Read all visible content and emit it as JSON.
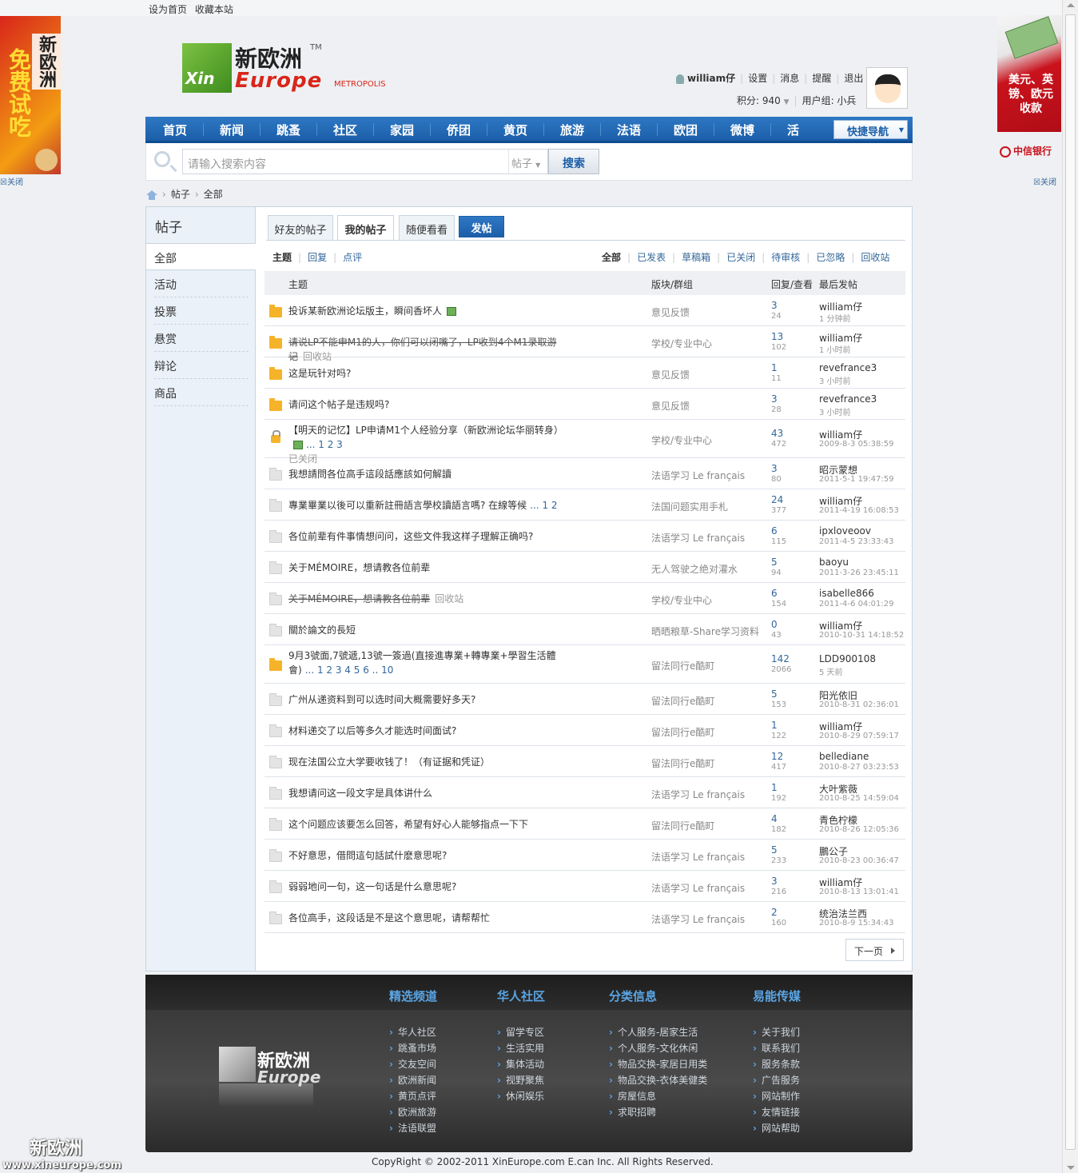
{
  "topbar": {
    "set_home": "设为首页",
    "bookmark": "收藏本站"
  },
  "ads": {
    "left_big": "免费试吃",
    "left_small": "新欧洲",
    "left_close": "☒关闭",
    "right_text": "美元、英镑、欧元收款",
    "right_bank": "中信银行",
    "right_close": "☒关闭"
  },
  "logo": {
    "cn": "新欧洲",
    "tm": "TM",
    "box": "Xin",
    "en": "Europe",
    "metro": "METROPOLIS"
  },
  "user": {
    "name": "william仔",
    "settings": "设置",
    "messages": "消息",
    "reminders": "提醒",
    "logout": "退出",
    "points": "积分: 940",
    "group": "用户组: 小兵"
  },
  "nav": {
    "items": [
      "首页",
      "新闻",
      "跳蚤",
      "社区",
      "家园",
      "侨团",
      "黄页",
      "旅游",
      "法语",
      "欧团",
      "微博",
      "活"
    ],
    "quick": "快捷导航"
  },
  "search": {
    "placeholder": "请输入搜索内容",
    "type": "帖子",
    "button": "搜索"
  },
  "breadcrumb": {
    "a": "帖子",
    "b": "全部"
  },
  "sidebar": {
    "title": "帖子",
    "current": "全部",
    "items": [
      "活动",
      "投票",
      "悬赏",
      "辩论",
      "商品"
    ]
  },
  "tabs": {
    "friends": "好友的帖子",
    "mine": "我的帖子",
    "random": "随便看看",
    "post": "发帖"
  },
  "filters": {
    "left": [
      "主题",
      "回复",
      "点评"
    ],
    "right": [
      "全部",
      "已发表",
      "草稿箱",
      "已关闭",
      "待审核",
      "已忽略",
      "回收站"
    ]
  },
  "table": {
    "headers": {
      "subject": "主题",
      "forum": "版块/群组",
      "replies": "回复/查看",
      "last": "最后发帖"
    },
    "rows": [
      {
        "subject": "投诉某新欧洲论坛版主，瞬间香坏人",
        "forum": "意见反馈",
        "replies": "3",
        "views": "24",
        "author": "william仔",
        "time": "1 分钟前"
      },
      {
        "subject": "请说LP不能申M1的人，你们可以闭嘴了，LP收到4个M1录取游记",
        "extra": "回收站",
        "forum": "学校/专业中心",
        "replies": "13",
        "views": "102",
        "author": "william仔",
        "time": "1 小时前"
      },
      {
        "subject": "这是玩针对吗?",
        "forum": "意见反馈",
        "replies": "1",
        "views": "11",
        "author": "revefrance3",
        "time": "3 小时前"
      },
      {
        "subject": "请问这个帖子是违规吗?",
        "forum": "意见反馈",
        "replies": "3",
        "views": "28",
        "author": "revefrance3",
        "time": "3 小时前"
      },
      {
        "subject": "【明天的记忆】LP申请M1个人经验分享（新欧洲论坛华丽转身）",
        "pages": "... 1 2 3",
        "extra2": "已关闭",
        "forum": "学校/专业中心",
        "replies": "43",
        "views": "472",
        "author": "william仔",
        "time": "2009-8-3 05:38:59"
      },
      {
        "subject": "我想請問各位高手這段話應該如何解讀",
        "forum": "法语学习 Le français",
        "replies": "3",
        "views": "80",
        "author": "昭示蒙想",
        "time": "2011-5-1 19:47:59"
      },
      {
        "subject": "專業畢業以後可以重新註冊語言學校讀語言嗎? 在線等候",
        "pages": "... 1 2",
        "forum": "法国问题实用手札",
        "replies": "24",
        "views": "377",
        "author": "william仔",
        "time": "2011-4-19 16:08:53"
      },
      {
        "subject": "各位前辈有件事情想问问，这些文件我这样子理解正确吗?",
        "forum": "法语学习 Le français",
        "replies": "6",
        "views": "115",
        "author": "ipxloveoov",
        "time": "2011-4-5 23:33:43"
      },
      {
        "subject": "关于MÉMOIRE，想请教各位前辈",
        "forum": "无人驾驶之绝对灌水",
        "replies": "5",
        "views": "94",
        "author": "baoyu",
        "time": "2011-3-26 23:45:11"
      },
      {
        "subject": "关于MÉMOIRE，想请教各位前辈",
        "extra": "回收站",
        "forum": "学校/专业中心",
        "replies": "6",
        "views": "154",
        "author": "isabelle866",
        "time": "2011-4-6 04:01:29"
      },
      {
        "subject": "關於論文的長短",
        "forum": "晒晒粮草-Share学习资料",
        "replies": "0",
        "views": "43",
        "author": "william仔",
        "time": "2010-10-31 14:18:52"
      },
      {
        "subject": "9月3號面,7號遞,13號一簽過(直接進專業+轉專業+學習生活體會)",
        "pages": "... 1 2 3 4 5 6 .. 10",
        "forum": "留法同行e酷町",
        "replies": "142",
        "views": "2066",
        "author": "LDD900108",
        "time": "5 天前"
      },
      {
        "subject": "广州从递资料到可以选时间大概需要好多天?",
        "forum": "留法同行e酷町",
        "replies": "5",
        "views": "153",
        "author": "阳光依旧",
        "time": "2010-8-31 02:36:01"
      },
      {
        "subject": "材料递交了以后等多久才能选时间面试?",
        "forum": "留法同行e酷町",
        "replies": "1",
        "views": "122",
        "author": "william仔",
        "time": "2010-8-29 07:59:17"
      },
      {
        "subject": "现在法国公立大学要收钱了！（有证据和凭证）",
        "forum": "留法同行e酷町",
        "replies": "12",
        "views": "417",
        "author": "bellediane",
        "time": "2010-8-27 03:23:53"
      },
      {
        "subject": "我想请问这一段文字是具体讲什么",
        "forum": "法语学习 Le français",
        "replies": "1",
        "views": "192",
        "author": "大叶紫薇",
        "time": "2010-8-25 14:59:04"
      },
      {
        "subject": "这个问题应该要怎么回答，希望有好心人能够指点一下下",
        "forum": "留法同行e酷町",
        "replies": "4",
        "views": "182",
        "author": "青色柠檬",
        "time": "2010-8-26 12:05:36"
      },
      {
        "subject": "不好意思，借問這句話試什麽意思呢?",
        "forum": "法语学习 Le français",
        "replies": "5",
        "views": "233",
        "author": "鵬公子",
        "time": "2010-8-23 00:36:47"
      },
      {
        "subject": "弱弱地问一句，这一句话是什么意思呢?",
        "forum": "法语学习 Le français",
        "replies": "3",
        "views": "216",
        "author": "william仔",
        "time": "2010-8-13 13:01:41"
      },
      {
        "subject": "各位高手，这段话是不是这个意思呢，请帮帮忙",
        "forum": "法语学习 Le français",
        "replies": "2",
        "views": "160",
        "author": "统治法兰西",
        "time": "2010-8-9 15:34:43"
      }
    ]
  },
  "pager": {
    "next": "下一页"
  },
  "footer": {
    "logo_cn": "新欧洲",
    "logo_box": "Xin",
    "logo_en": "Europe",
    "cols": [
      {
        "title": "精选频道",
        "links": [
          "华人社区",
          "跳蚤市场",
          "交友空间",
          "欧洲新闻",
          "黄页点评",
          "欧洲旅游",
          "法语联盟"
        ]
      },
      {
        "title": "华人社区",
        "links": [
          "留学专区",
          "生活实用",
          "集体活动",
          "视野聚焦",
          "休闲娱乐"
        ]
      },
      {
        "title": "分类信息",
        "links": [
          "个人服务-居家生活",
          "个人服务-文化休闲",
          "物品交换-家居日用类",
          "物品交换-衣体美健类",
          "房屋信息",
          "求职招聘"
        ]
      },
      {
        "title": "易能传媒",
        "links": [
          "关于我们",
          "联系我们",
          "服务条款",
          "广告服务",
          "网站制作",
          "友情链接",
          "网站帮助"
        ]
      }
    ],
    "copyright": "CopyRight © 2002-2011 XinEurope.com E.can Inc. All Rights Reserved."
  },
  "watermark": {
    "cn": "新欧洲",
    "url": "www.xineurope.com"
  }
}
